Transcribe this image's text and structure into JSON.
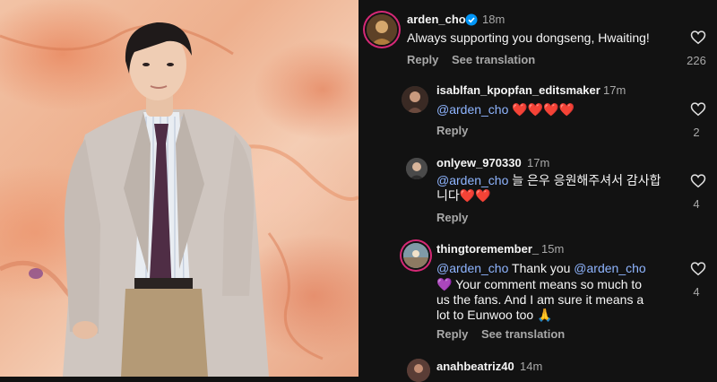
{
  "comments": [
    {
      "username": "arden_cho",
      "verified": true,
      "time": "18m",
      "text": "Always supporting you dongseng, Hwaiting!",
      "reply_label": "Reply",
      "see_translation_label": "See translation",
      "likes": "226"
    },
    {
      "username": "isablfan_kpopfan_editsmaker",
      "time": "17m",
      "mention": "@arden_cho",
      "text": "❤️❤️❤️❤️",
      "reply_label": "Reply",
      "likes": "2"
    },
    {
      "username": "onlyew_970330",
      "time": "17m",
      "mention": "@arden_cho",
      "text_line1": "늘 은우 응원해주셔서 감사합",
      "text_line2": "니다❤️❤️",
      "reply_label": "Reply",
      "likes": "4"
    },
    {
      "username": "thingtoremember_",
      "time": "15m",
      "mention1": "@arden_cho",
      "text_a": " Thank you ",
      "mention2": "@arden_cho",
      "text_line2": "💜  Your comment means so much to",
      "text_line3": "us the fans.  And I am sure it means a",
      "text_line4": "lot to Eunwoo too 🙏",
      "reply_label": "Reply",
      "see_translation_label": "See translation",
      "likes": "4"
    },
    {
      "username": "anahbeatriz40",
      "time": "14m"
    }
  ],
  "icons": {
    "like": "heart-outline-icon",
    "verified": "verified-badge-icon"
  },
  "colors": {
    "background": "#121212",
    "mention": "#8fb5ff",
    "verified": "#0095f6",
    "story_ring": "#d62976"
  }
}
